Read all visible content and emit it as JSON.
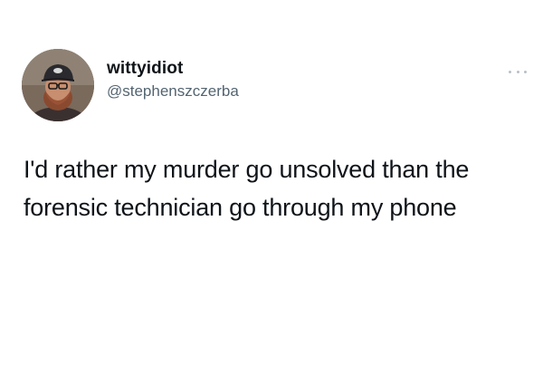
{
  "user": {
    "display_name": "wittyidiot",
    "handle": "@stephenszczerba"
  },
  "icons": {
    "avatar": "profile-photo",
    "more": "more-horizontal-icon"
  },
  "tweet": {
    "text": "I'd rather my murder go unsolved than the forensic technician go through my phone"
  },
  "colors": {
    "text": "#0f1419",
    "handle": "#536471",
    "background": "#ffffff"
  }
}
